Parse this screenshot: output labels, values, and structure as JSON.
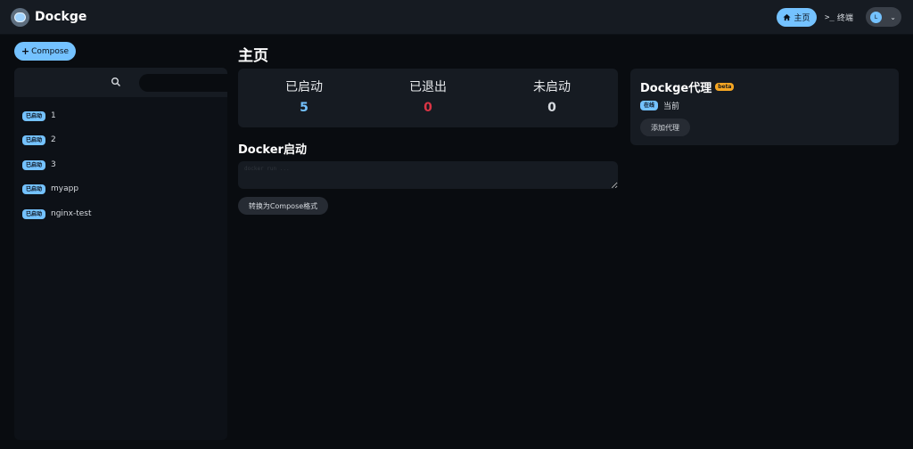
{
  "brand": {
    "name": "Dockge"
  },
  "nav": {
    "home_label": "主页",
    "terminal_label": "终端",
    "avatar_initial": "L"
  },
  "compose_button": {
    "label": "Compose"
  },
  "search": {
    "placeholder": ""
  },
  "stacks": [
    {
      "status": "已启动",
      "name": "1"
    },
    {
      "status": "已启动",
      "name": "2"
    },
    {
      "status": "已启动",
      "name": "3"
    },
    {
      "status": "已启动",
      "name": "myapp"
    },
    {
      "status": "已启动",
      "name": "nginx-test"
    }
  ],
  "main": {
    "title": "主页",
    "stats": {
      "running_label": "已启动",
      "running_value": "5",
      "exited_label": "已退出",
      "exited_value": "0",
      "inactive_label": "未启动",
      "inactive_value": "0"
    },
    "docker_run": {
      "title": "Docker启动",
      "placeholder": "docker run ...",
      "convert_label": "转换为Compose格式"
    }
  },
  "agents": {
    "title": "Dockge代理",
    "beta_label": "beta",
    "online_badge": "在线",
    "current_label": "当前",
    "add_label": "添加代理"
  },
  "colors": {
    "accent": "#74c2ff",
    "danger": "#dc3545",
    "warning": "#f5a623",
    "background": "#090c10",
    "card": "#161b22"
  }
}
